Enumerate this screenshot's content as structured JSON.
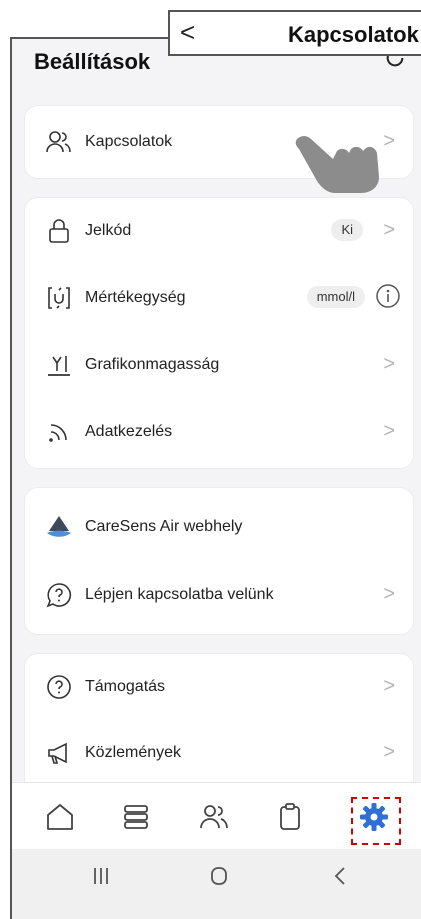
{
  "callout": {
    "back_glyph": "<",
    "title": "Kapcsolatok"
  },
  "header": {
    "title": "Beállítások"
  },
  "rows": {
    "kapcsolatok": {
      "label": "Kapcsolatok"
    },
    "jelkod": {
      "label": "Jelkód",
      "badge": "Ki"
    },
    "mertekegyseg": {
      "label": "Mértékegység",
      "badge": "mmol/l"
    },
    "grafikon": {
      "label": "Grafikonmagasság"
    },
    "adatkezeles": {
      "label": "Adatkezelés"
    },
    "webhely": {
      "label": "CareSens Air webhely"
    },
    "kapcsolat": {
      "label": "Lépjen kapcsolatba velünk"
    },
    "tamogatas": {
      "label": "Támogatás"
    },
    "kozlemenyek": {
      "label": "Közlemények"
    }
  },
  "chevron": ">",
  "colors": {
    "accent": "#2f6fd6",
    "highlight": "#d60000",
    "chevron": "#b3b3b3"
  }
}
